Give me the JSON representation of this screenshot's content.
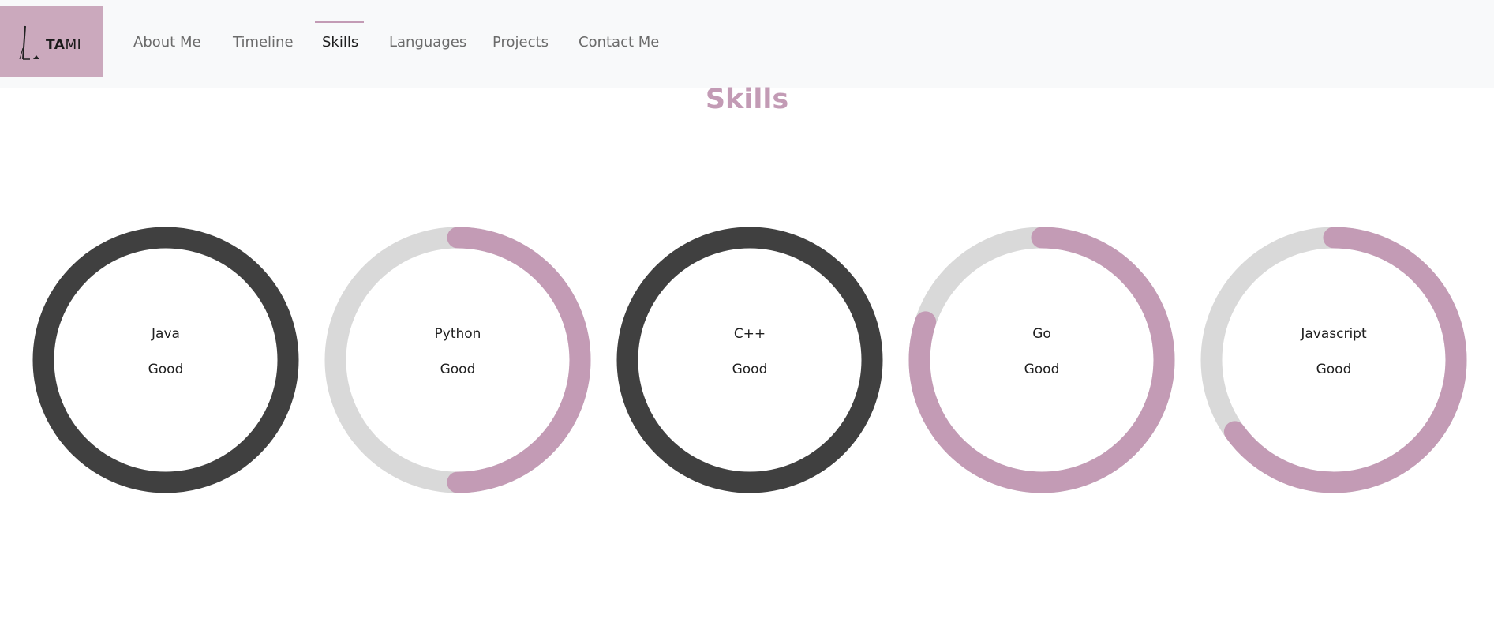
{
  "logo": {
    "brand_bold": "TA",
    "brand_light": "MI"
  },
  "nav": {
    "items": [
      {
        "label": "About Me",
        "active": false
      },
      {
        "label": "Timeline",
        "active": false
      },
      {
        "label": "Skills",
        "active": true
      },
      {
        "label": "Languages",
        "active": false
      },
      {
        "label": "Projects",
        "active": false
      },
      {
        "label": "Contact Me",
        "active": false
      }
    ]
  },
  "section": {
    "title": "Skills"
  },
  "colors": {
    "accent": "#c39bb5",
    "track": "#d9d9d9",
    "full_ring": "#404040",
    "logo_bg": "#cba9bd",
    "navbar_bg": "#f8f9fa"
  },
  "skills": [
    {
      "name": "Java",
      "level": "Good",
      "progress": 1.0
    },
    {
      "name": "Python",
      "level": "Good",
      "progress": 0.5
    },
    {
      "name": "C++",
      "level": "Good",
      "progress": 1.0
    },
    {
      "name": "Go",
      "level": "Good",
      "progress": 0.8
    },
    {
      "name": "Javascript",
      "level": "Good",
      "progress": 0.65
    }
  ]
}
